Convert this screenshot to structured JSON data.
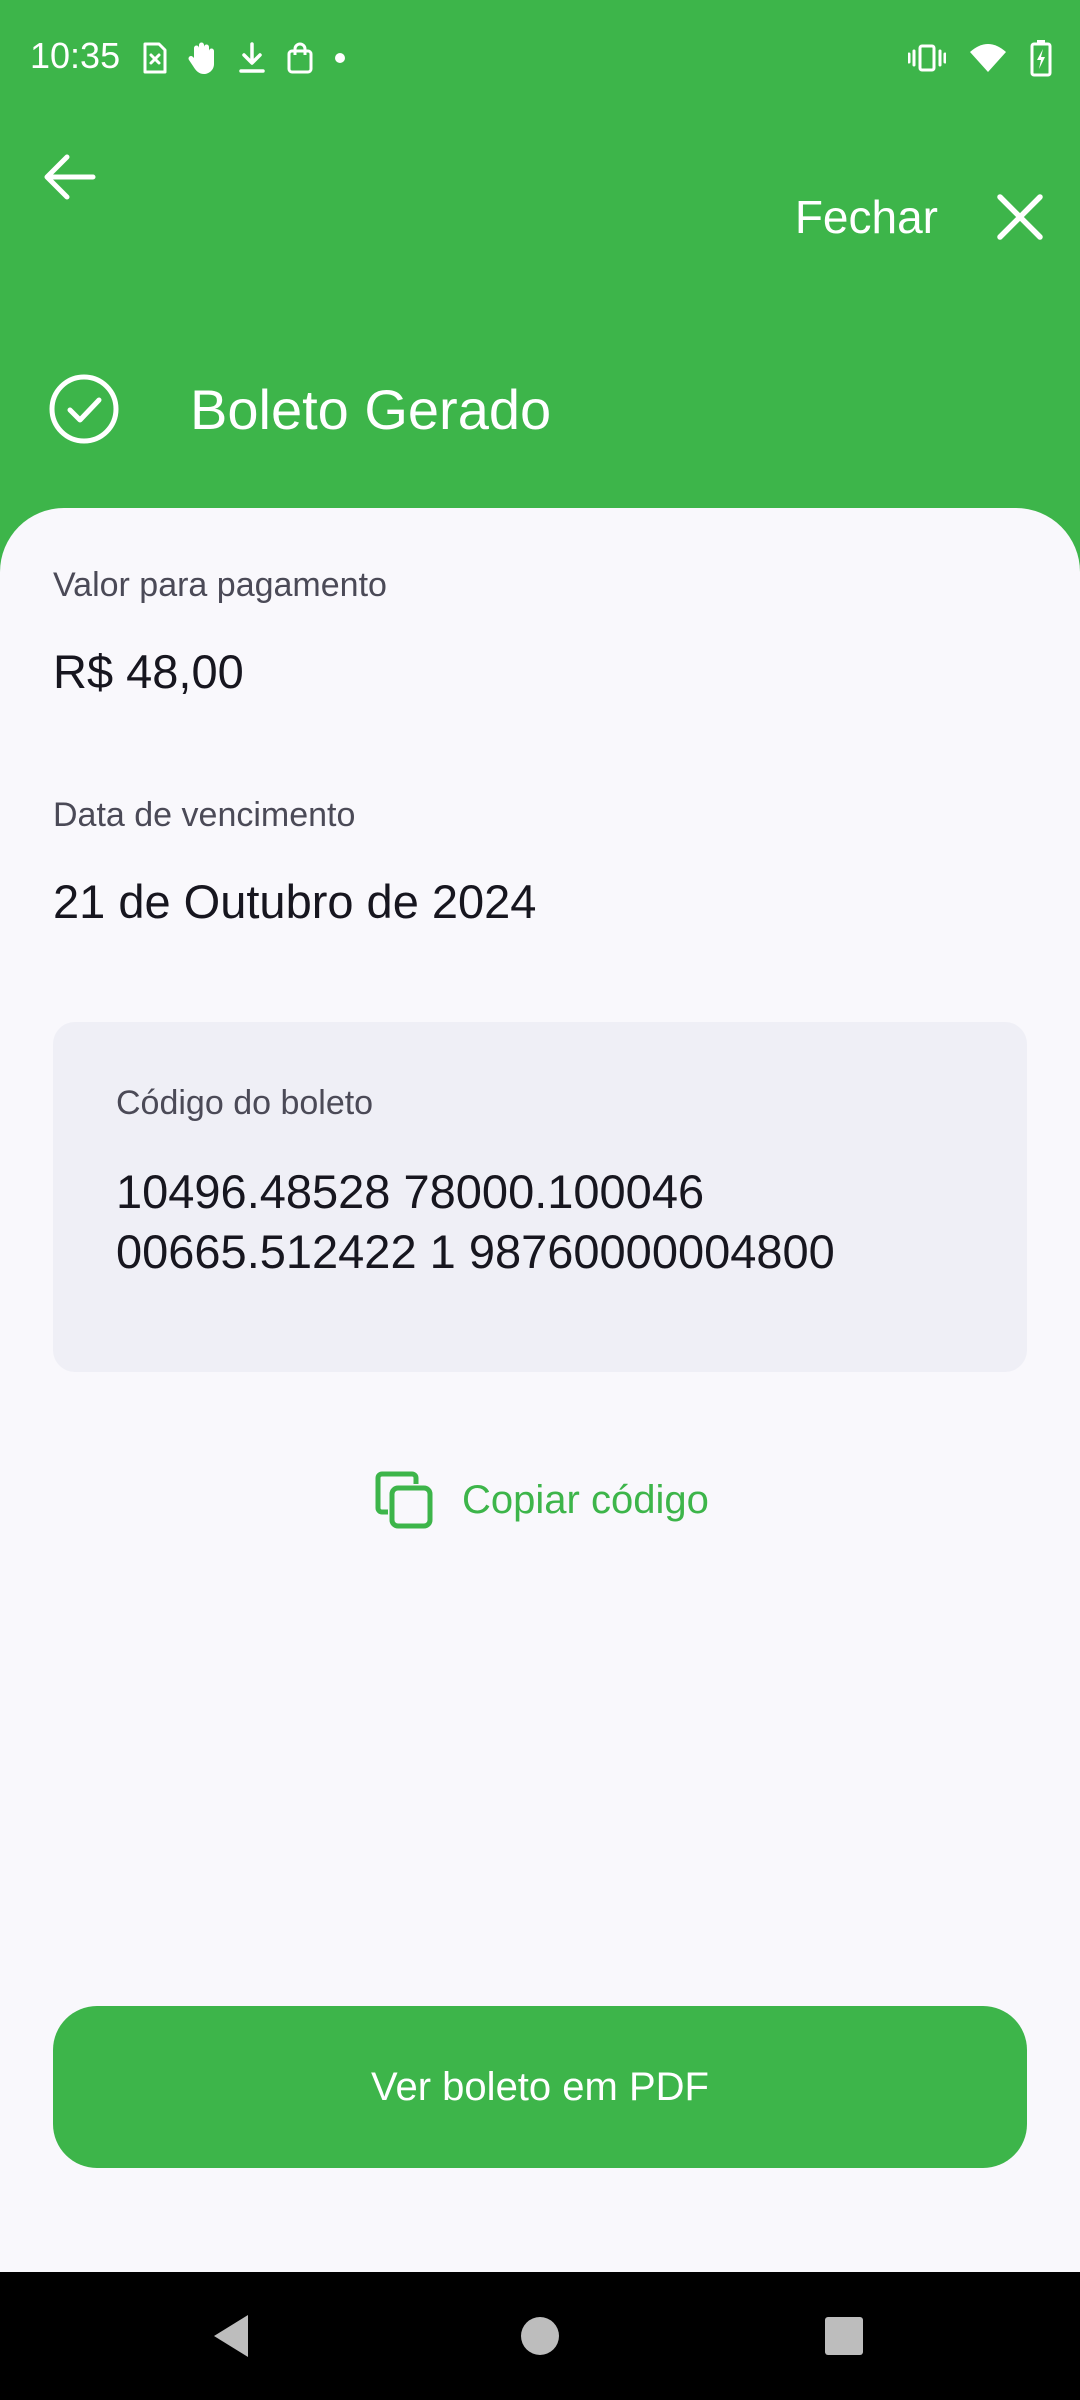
{
  "status_bar": {
    "time": "10:35"
  },
  "top_bar": {
    "close_label": "Fechar"
  },
  "header": {
    "title": "Boleto Gerado"
  },
  "payment": {
    "amount_label": "Valor para pagamento",
    "amount_value": "R$ 48,00",
    "due_label": "Data de vencimento",
    "due_value": "21 de Outubro de 2024"
  },
  "code_card": {
    "label": "Código do boleto",
    "lines": [
      "10496.48528 78000.100046",
      "00665.512422 1 98760000004800"
    ]
  },
  "actions": {
    "copy_label": "Copiar código",
    "pdf_label": "Ver boleto em PDF"
  },
  "colors": {
    "brand": "#3db54a",
    "sheet": "#f9f8fc",
    "card": "#efeff6",
    "text": "#17161f",
    "muted": "#4b4a57"
  }
}
